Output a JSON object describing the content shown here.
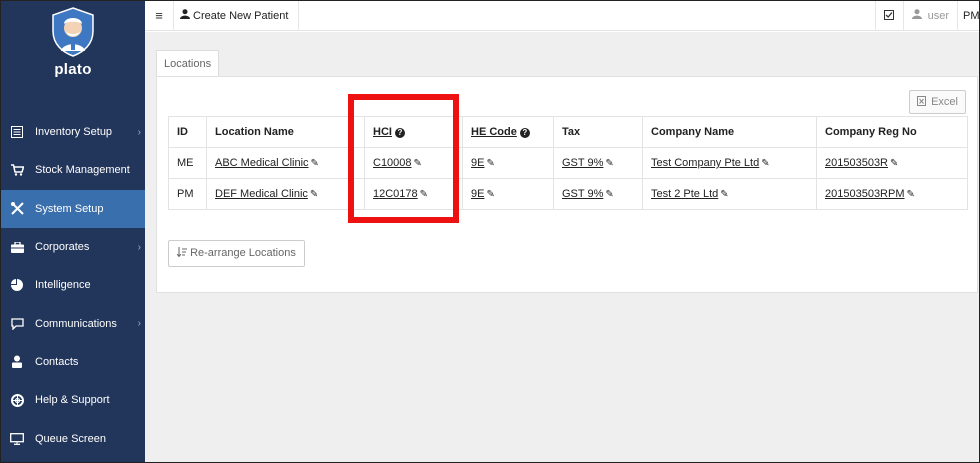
{
  "app": {
    "brand": "plato"
  },
  "sidebar": {
    "items": [
      {
        "label": "Inventory Setup",
        "icon": "list-icon",
        "chevron": true,
        "active": false
      },
      {
        "label": "Stock Management",
        "icon": "cart-icon",
        "chevron": false,
        "active": false
      },
      {
        "label": "System Setup",
        "icon": "tools-icon",
        "chevron": false,
        "active": true
      },
      {
        "label": "Corporates",
        "icon": "briefcase-icon",
        "chevron": true,
        "active": false
      },
      {
        "label": "Intelligence",
        "icon": "pie-chart-icon",
        "chevron": false,
        "active": false
      },
      {
        "label": "Communications",
        "icon": "chat-icon",
        "chevron": true,
        "active": false
      },
      {
        "label": "Contacts",
        "icon": "contacts-icon",
        "chevron": false,
        "active": false
      },
      {
        "label": "Help & Support",
        "icon": "lifebuoy-icon",
        "chevron": false,
        "active": false
      },
      {
        "label": "Queue Screen",
        "icon": "monitor-icon",
        "chevron": false,
        "active": false
      }
    ]
  },
  "topbar": {
    "create_label": "Create New Patient",
    "user_label": "user",
    "clinic_code": "PM"
  },
  "main": {
    "tab_label": "Locations",
    "excel_label": "Excel",
    "rearrange_label": "Re-arrange Locations",
    "columns": [
      "ID",
      "Location Name",
      "HCI",
      "HE Code",
      "Tax",
      "Company Name",
      "Company Reg No"
    ],
    "rows": [
      {
        "id": "ME",
        "location_name": "ABC Medical Clinic",
        "hci": "C10008",
        "he_code": "9E",
        "tax": "GST 9%",
        "company_name": "Test Company Pte Ltd",
        "company_reg_no": "201503503R"
      },
      {
        "id": "PM",
        "location_name": "DEF Medical Clinic",
        "hci": "12C0178",
        "he_code": "9E",
        "tax": "GST 9%",
        "company_name": "Test 2 Pte Ltd",
        "company_reg_no": "201503503RPM"
      }
    ]
  },
  "colors": {
    "sidebar_bg": "#22355a",
    "active_item": "#3a6fae",
    "highlight": "#ee1111"
  }
}
